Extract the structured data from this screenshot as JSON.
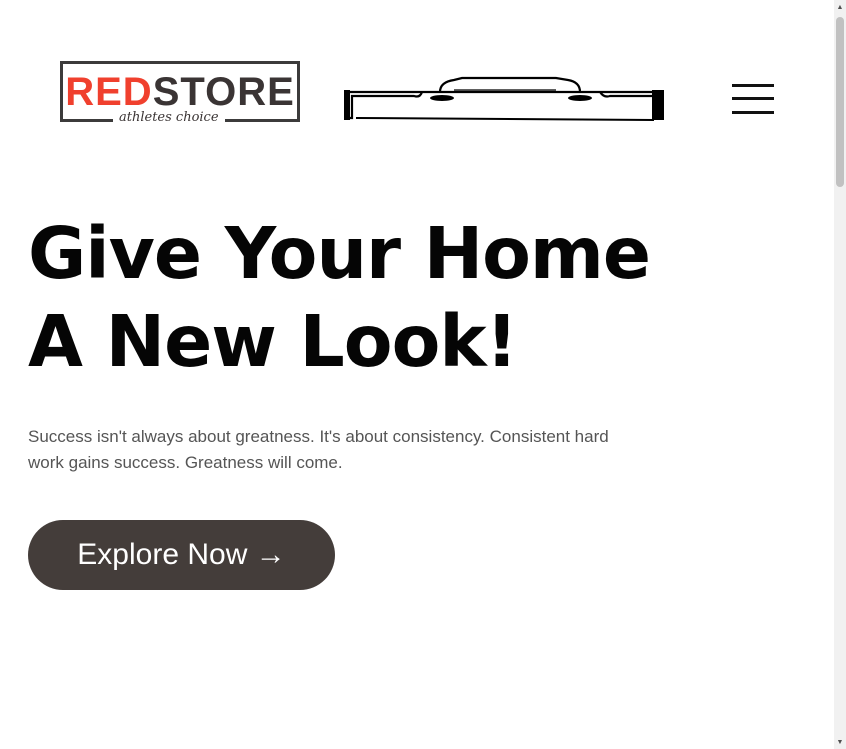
{
  "header": {
    "logo": {
      "brand_red": "RED",
      "brand_dark": "STORE",
      "tagline": "athletes choice"
    },
    "menu_icon": "hamburger-menu-icon"
  },
  "hero": {
    "title_line1": "Give Your Home",
    "title_line2": "A New Look!",
    "description": "Success isn't always about greatness. It's about consistency. Consistent hard work gains success. Greatness will come.",
    "cta_label": "Explore Now →"
  },
  "colors": {
    "brand_red": "#f0402e",
    "brand_dark": "#3a3434",
    "cta_background": "#443d3a",
    "body_text": "#555555"
  }
}
